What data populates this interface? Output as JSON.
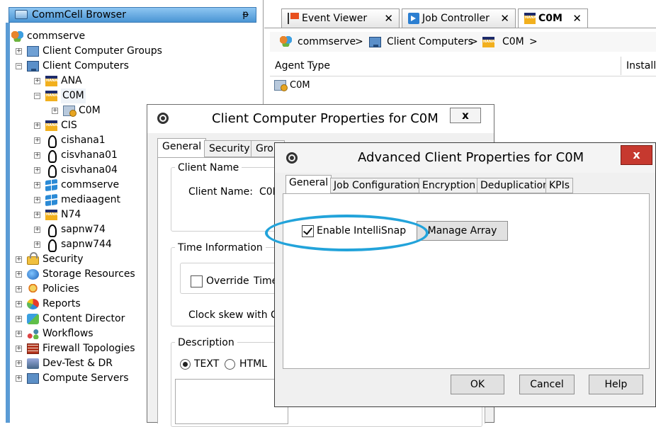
{
  "left_panel": {
    "title": "CommCell Browser",
    "pin_glyph": "ᵽ",
    "tree": [
      {
        "label": "commserve",
        "icon": "commcell-icon",
        "level": 0,
        "expander": ""
      },
      {
        "label": "Client Computer Groups",
        "icon": "computer-group-icon",
        "level": 1,
        "expander": "+"
      },
      {
        "label": "Client Computers",
        "icon": "client-computers-icon",
        "level": 1,
        "expander": "−"
      },
      {
        "label": "ANA",
        "icon": "hana-icon",
        "level": 2,
        "expander": "+"
      },
      {
        "label": "C0M",
        "icon": "hana-icon",
        "level": 2,
        "expander": "−",
        "selected": true
      },
      {
        "label": "C0M",
        "icon": "agent-icon",
        "level": 3,
        "expander": "+"
      },
      {
        "label": "CIS",
        "icon": "hana-icon",
        "level": 2,
        "expander": "+"
      },
      {
        "label": "cishana1",
        "icon": "linux-icon",
        "level": 2,
        "expander": "+"
      },
      {
        "label": "cisvhana01",
        "icon": "linux-icon",
        "level": 2,
        "expander": "+"
      },
      {
        "label": "cisvhana04",
        "icon": "linux-icon",
        "level": 2,
        "expander": "+"
      },
      {
        "label": "commserve",
        "icon": "windows-icon",
        "level": 2,
        "expander": "+"
      },
      {
        "label": "mediaagent",
        "icon": "windows-icon",
        "level": 2,
        "expander": "+"
      },
      {
        "label": "N74",
        "icon": "hana-icon",
        "level": 2,
        "expander": "+"
      },
      {
        "label": "sapnw74",
        "icon": "linux-icon",
        "level": 2,
        "expander": "+"
      },
      {
        "label": "sapnw744",
        "icon": "linux-icon",
        "level": 2,
        "expander": "+"
      },
      {
        "label": "Security",
        "icon": "lock-icon",
        "level": 1,
        "expander": "+"
      },
      {
        "label": "Storage Resources",
        "icon": "globe-icon",
        "level": 1,
        "expander": "+"
      },
      {
        "label": "Policies",
        "icon": "policy-icon",
        "level": 1,
        "expander": "+"
      },
      {
        "label": "Reports",
        "icon": "reports-icon",
        "level": 1,
        "expander": "+"
      },
      {
        "label": "Content Director",
        "icon": "content-director-icon",
        "level": 1,
        "expander": "+"
      },
      {
        "label": "Workflows",
        "icon": "workflow-icon",
        "level": 1,
        "expander": "+"
      },
      {
        "label": "Firewall Topologies",
        "icon": "firewall-icon",
        "level": 1,
        "expander": "+"
      },
      {
        "label": "Dev-Test & DR",
        "icon": "devtest-icon",
        "level": 1,
        "expander": "+"
      },
      {
        "label": "Compute Servers",
        "icon": "compute-servers-icon",
        "level": 1,
        "expander": "+"
      }
    ]
  },
  "tabs": [
    {
      "label": "Event Viewer",
      "icon": "flag-icon",
      "close": "✕"
    },
    {
      "label": "Job Controller",
      "icon": "play-icon",
      "close": "✕"
    },
    {
      "label": "C0M",
      "icon": "hana-icon",
      "close": "✕",
      "active": true
    }
  ],
  "breadcrumb": {
    "items": [
      "commserve",
      "Client Computers",
      "C0M"
    ],
    "separator": ">"
  },
  "grid": {
    "columns": [
      "Agent Type",
      "Install"
    ],
    "rows": [
      [
        "C0M"
      ]
    ]
  },
  "client_props_dialog": {
    "title": "Client Computer Properties for C0M",
    "close": "x",
    "tabs": [
      "General",
      "Security",
      "Grou",
      "",
      ""
    ],
    "client_name_group": "Client Name",
    "client_name_label": "Client Name:",
    "client_name_value": "C0M",
    "time_group": "Time Information",
    "override_label": "Override",
    "time_label": "Time",
    "clock_skew_label": "Clock skew with Co",
    "description_group": "Description",
    "radio_text": "TEXT",
    "radio_html": "HTML",
    "radio_selected": "TEXT"
  },
  "advanced_dialog": {
    "title": "Advanced Client Properties for C0M",
    "close": "x",
    "tabs": [
      "General",
      "Job Configuration",
      "Encryption",
      "Deduplication",
      "KPIs"
    ],
    "active_tab": "General",
    "enable_intellisnap_label": "Enable IntelliSnap",
    "enable_intellisnap_checked": true,
    "manage_array_label": "Manage Array",
    "buttons": {
      "ok": "OK",
      "cancel": "Cancel",
      "help": "Help"
    },
    "highlight_color": "#22a3da",
    "close_color": "#c6392f"
  }
}
